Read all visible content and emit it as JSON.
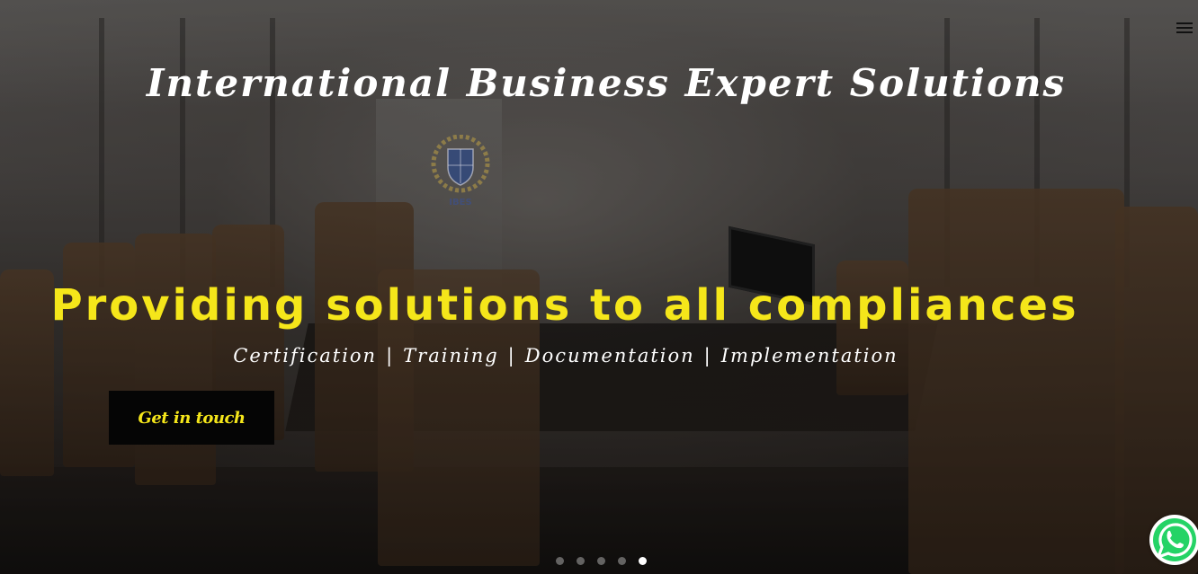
{
  "header": {
    "title": "International Business Expert Solutions",
    "menu_icon": "hamburger-menu-icon"
  },
  "hero": {
    "logo_text": "IBES",
    "headline": "Providing solutions to all compliances",
    "services": [
      "Certification",
      "Training",
      "Documentation",
      "Implementation"
    ],
    "services_separator": "|",
    "cta_label": "Get in touch"
  },
  "slider": {
    "total_slides": 5,
    "active_slide": 5
  },
  "floating": {
    "whatsapp_icon": "whatsapp-icon"
  },
  "colors": {
    "headline": "#f5e61a",
    "cta_text": "#f5e61a",
    "cta_background": "#050505",
    "title": "#ffffff",
    "whatsapp": "#25d366"
  }
}
